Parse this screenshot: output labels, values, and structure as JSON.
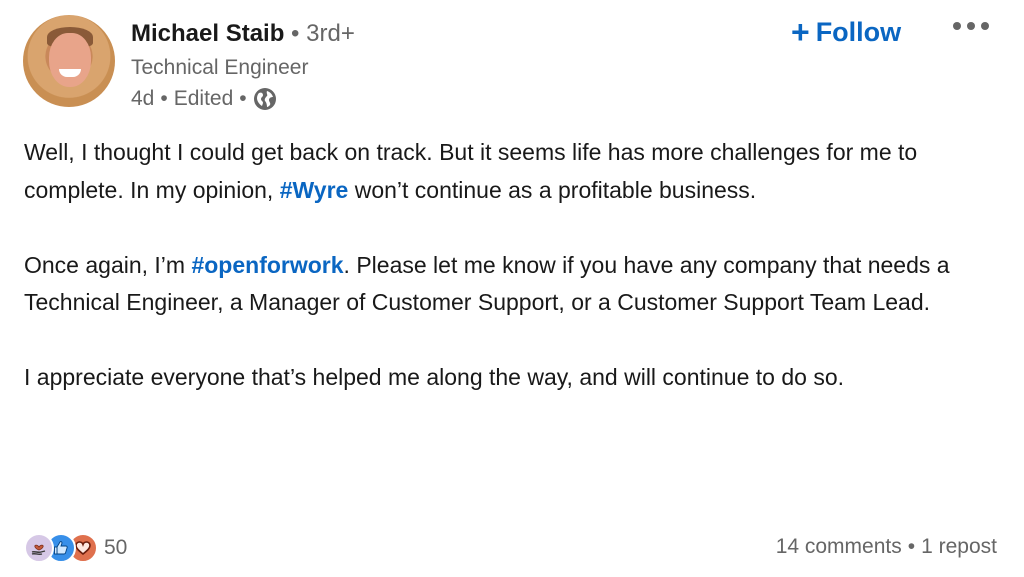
{
  "author": {
    "name": "Michael Staib",
    "separator": "•",
    "degree": "3rd+",
    "headline": "Technical Engineer",
    "time": "4d",
    "edited": "Edited",
    "visibility_icon": "globe-icon"
  },
  "actions": {
    "follow_icon": "+",
    "follow_label": "Follow",
    "more_icon": "ellipsis-icon"
  },
  "post": {
    "paragraphs": [
      {
        "before": "Well, I thought I could get back on track. But it seems life has more challenges for me to complete. In my opinion, ",
        "hashtag": "#Wyre",
        "after": " won’t continue as a profitable business."
      },
      {
        "before": "Once again, I’m ",
        "hashtag": "#openforwork",
        "after": ". Please let me know if you have any company that needs a Technical Engineer, a Manager of Customer Support, or a Customer Support Team Lead."
      },
      {
        "text": "I appreciate everyone that’s helped me along the way, and will continue to do so."
      }
    ]
  },
  "social": {
    "reaction_icons": [
      "support-icon",
      "like-icon",
      "love-icon"
    ],
    "reaction_count": "50",
    "comments": "14 comments",
    "separator": "•",
    "reposts": "1 repost"
  },
  "colors": {
    "brand_blue": "#0a66c2",
    "muted_text": "#666666",
    "body_text": "#191919"
  }
}
